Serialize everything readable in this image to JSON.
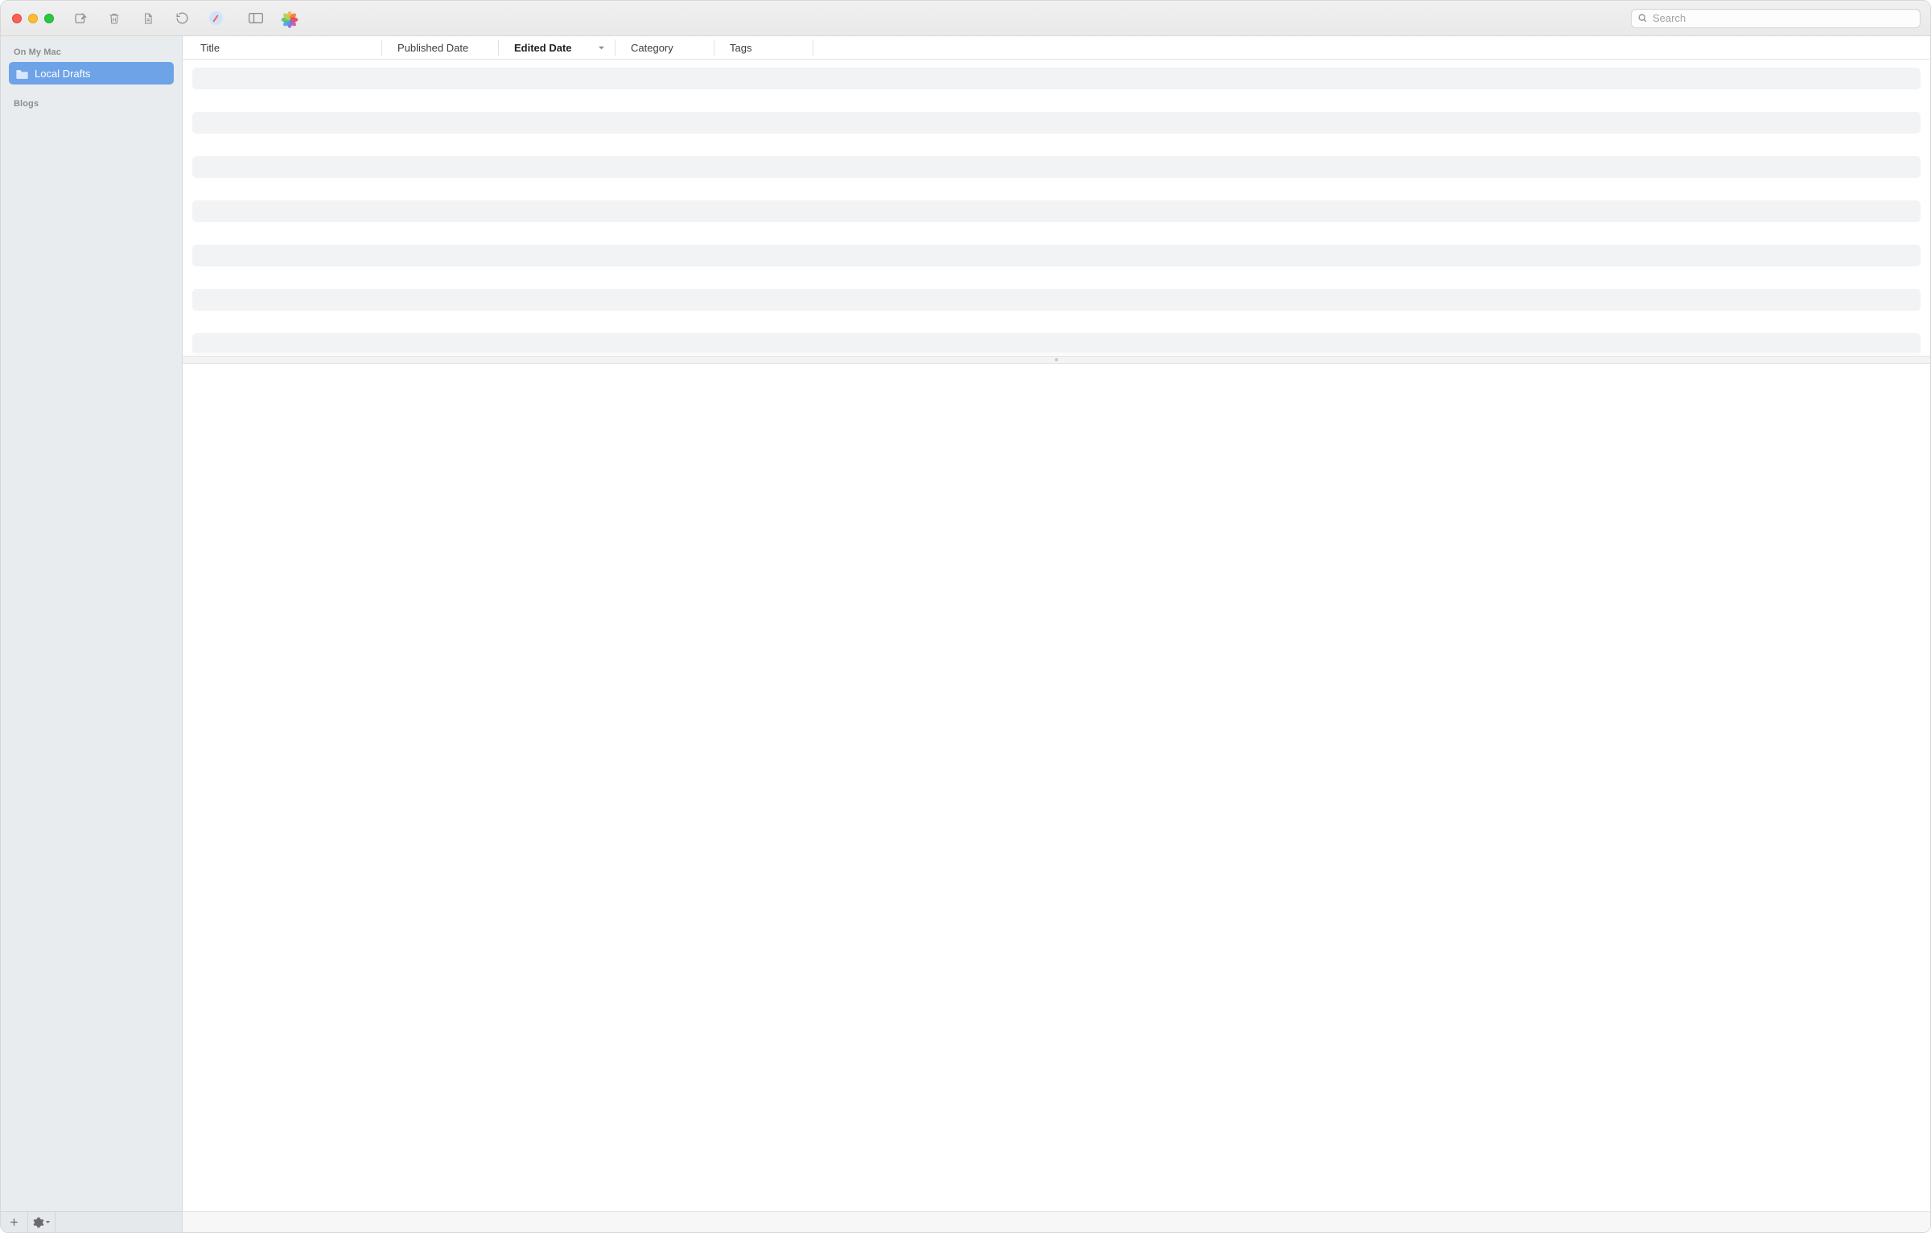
{
  "toolbar": {
    "compose": "New Post",
    "trash": "Move to Trash",
    "refresh": "Refresh",
    "preview": "Preview",
    "safari": "Open in Safari",
    "sidebar_toggle": "Toggle Sidebar",
    "photos": "Photos"
  },
  "search": {
    "placeholder": "Search"
  },
  "sidebar": {
    "sections": [
      {
        "header": "On My Mac",
        "items": [
          {
            "label": "Local Drafts",
            "selected": true
          }
        ]
      },
      {
        "header": "Blogs",
        "items": []
      }
    ],
    "footer": {
      "add": "Add",
      "settings": "Settings"
    }
  },
  "columns": {
    "title": "Title",
    "published": "Published Date",
    "edited": "Edited Date",
    "category": "Category",
    "tags": "Tags",
    "sort_column": "edited",
    "sort_direction": "desc"
  }
}
